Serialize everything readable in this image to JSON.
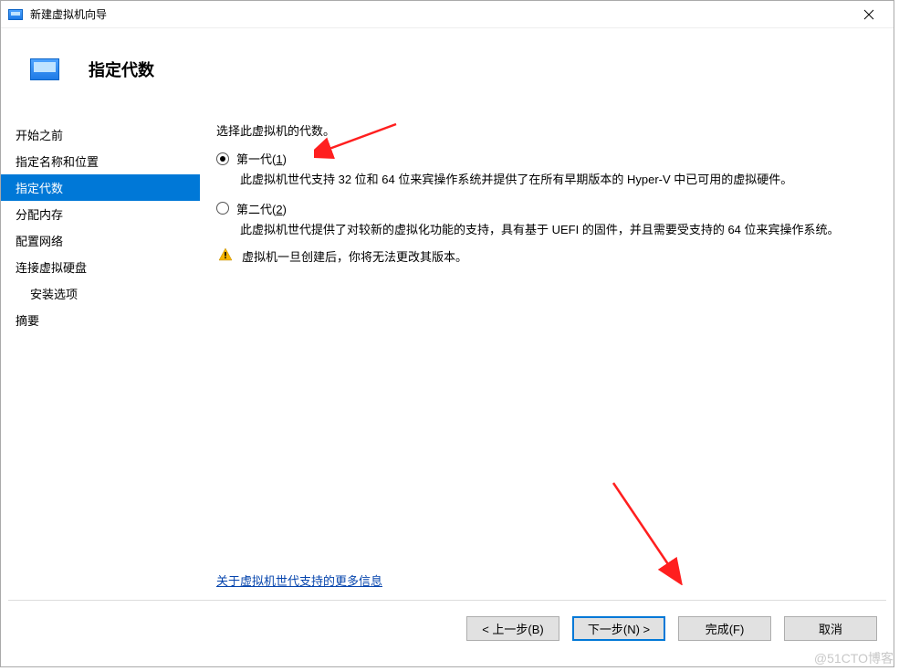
{
  "window": {
    "title": "新建虚拟机向导"
  },
  "header": {
    "title": "指定代数"
  },
  "sidebar": {
    "items": [
      {
        "label": "开始之前"
      },
      {
        "label": "指定名称和位置"
      },
      {
        "label": "指定代数",
        "selected": true
      },
      {
        "label": "分配内存"
      },
      {
        "label": "配置网络"
      },
      {
        "label": "连接虚拟硬盘"
      },
      {
        "label": "安装选项",
        "indent": true
      },
      {
        "label": "摘要"
      }
    ]
  },
  "content": {
    "prompt": "选择此虚拟机的代数。",
    "option1": {
      "prefix": "第一代(",
      "accel": "1",
      "suffix": ")",
      "desc": "此虚拟机世代支持 32 位和 64 位来宾操作系统并提供了在所有早期版本的 Hyper-V 中已可用的虚拟硬件。"
    },
    "option2": {
      "prefix": "第二代(",
      "accel": "2",
      "suffix": ")",
      "desc": "此虚拟机世代提供了对较新的虚拟化功能的支持，具有基于 UEFI 的固件，并且需要受支持的 64 位来宾操作系统。"
    },
    "warning": "虚拟机一旦创建后，你将无法更改其版本。",
    "link": "关于虚拟机世代支持的更多信息"
  },
  "footer": {
    "back": "< 上一步(B)",
    "next": "下一步(N) >",
    "finish": "完成(F)",
    "cancel": "取消"
  },
  "watermark": "@51CTO博客"
}
